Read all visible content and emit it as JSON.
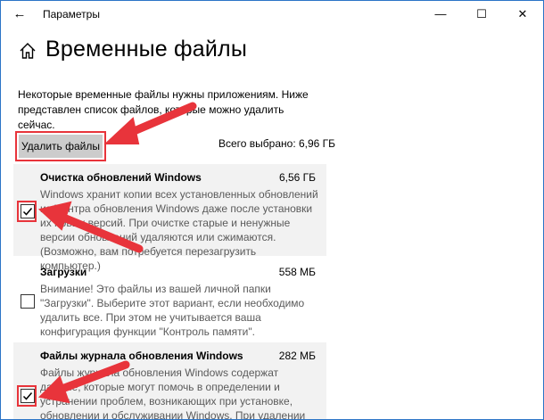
{
  "window": {
    "title": "Параметры",
    "back_icon": "back-arrow-icon",
    "controls": {
      "minimize": "—",
      "maximize": "☐",
      "close": "✕"
    }
  },
  "header": {
    "home_icon": "home-icon",
    "title": "Временные файлы"
  },
  "description": "Некоторые временные файлы нужны приложениям. Ниже представлен список файлов, которые можно удалить сейчас.",
  "actions": {
    "delete_label": "Удалить файлы",
    "total_selected": "Всего выбрано: 6,96 ГБ"
  },
  "items": [
    {
      "title": "Очистка обновлений Windows",
      "size": "6,56 ГБ",
      "checked": true,
      "description": "Windows хранит копии всех установленных обновлений из Центра обновления Windows даже после установки их новых версий. При очистке старые и ненужные версии обновлений удаляются или сжимаются. (Возможно, вам потребуется перезагрузить компьютер.)"
    },
    {
      "title": "Загрузки",
      "size": "558 МБ",
      "checked": false,
      "description": "Внимание! Это файлы из вашей личной папки \"Загрузки\". Выберите этот вариант, если необходимо удалить все. При этом не учитывается ваша конфигурация функции \"Контроль памяти\"."
    },
    {
      "title": "Файлы журнала обновления Windows",
      "size": "282 МБ",
      "checked": true,
      "description": "Файлы журнала обновления Windows содержат данные, которые могут помочь в определении и устранении проблем, возникающих при установке, обновлении и обслуживании Windows. При удалении этих файлов"
    }
  ],
  "colors": {
    "annotation": "#e8343b",
    "button_bg": "#cccccc",
    "item_shade": "#f2f2f2"
  }
}
